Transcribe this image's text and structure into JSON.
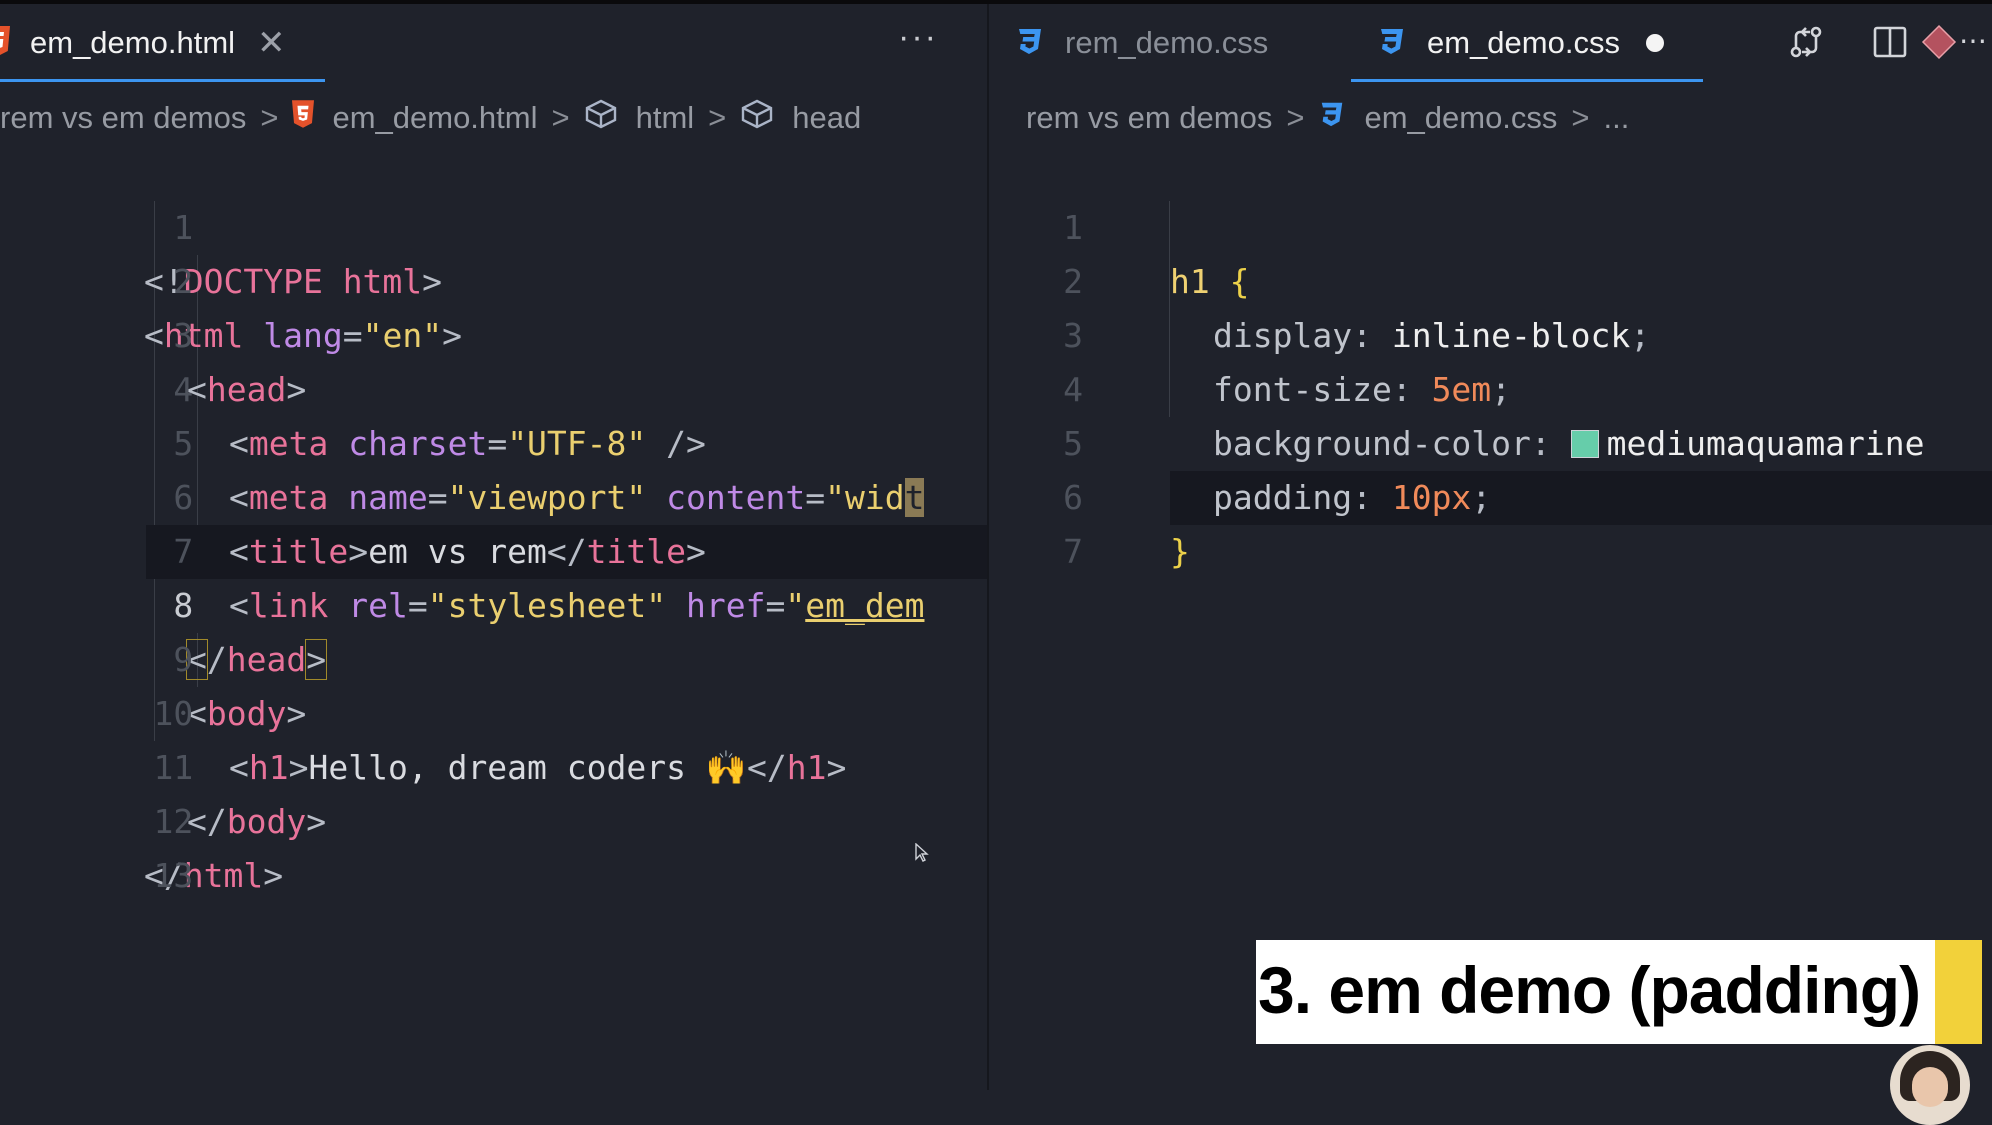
{
  "left_pane": {
    "tab": {
      "label": "em_demo.html",
      "icon": "html5-icon",
      "close_glyph": "✕",
      "active": true
    },
    "more_glyph": "···",
    "breadcrumb": [
      "rem vs em demos",
      "em_demo.html",
      "html",
      "head"
    ],
    "separator": ">",
    "lines": [
      {
        "n": "1"
      },
      {
        "n": "2"
      },
      {
        "n": "3"
      },
      {
        "n": "4"
      },
      {
        "n": "5"
      },
      {
        "n": "6"
      },
      {
        "n": "7"
      },
      {
        "n": "8"
      },
      {
        "n": "9"
      },
      {
        "n": "10"
      },
      {
        "n": "11"
      },
      {
        "n": "12"
      },
      {
        "n": "13"
      }
    ],
    "code": {
      "l1": {
        "a": "<!",
        "b": "DOCTYPE html",
        "c": ">"
      },
      "l2": {
        "a": "<",
        "b": "html",
        "c": "lang",
        "d": "=",
        "e": "\"en\"",
        "f": ">"
      },
      "l3": {
        "a": "<",
        "b": "head",
        "c": ">"
      },
      "l4": {
        "a": "<",
        "b": "meta",
        "c": "charset",
        "d": "=",
        "e": "\"UTF-8\"",
        "f": "/>"
      },
      "l5": {
        "a": "<",
        "b": "meta",
        "c": "name",
        "d": "=",
        "e": "\"viewport\"",
        "f": "content",
        "g": "=",
        "h": "\"wid",
        "i": "t"
      },
      "l6": {
        "a": "<",
        "b": "title",
        "c": ">",
        "d": "em vs rem",
        "e": "</",
        "f": "title",
        "g": ">"
      },
      "l7": {
        "a": "<",
        "b": "link",
        "c": "rel",
        "d": "=",
        "e": "\"stylesheet\"",
        "f": "href",
        "g": "=",
        "h": "\"",
        "i": "em_dem"
      },
      "l8": {
        "a": "<",
        "b": "/",
        "c": "head",
        "d": ">"
      },
      "l9": {
        "a": "<",
        "b": "body",
        "c": ">"
      },
      "l10": {
        "a": "<",
        "b": "h1",
        "c": ">",
        "d": "Hello, dream coders 🙌",
        "e": "</",
        "f": "h1",
        "g": ">"
      },
      "l11": {
        "a": "</",
        "b": "body",
        "c": ">"
      },
      "l12": {
        "a": "</",
        "b": "html",
        "c": ">"
      }
    }
  },
  "right_pane": {
    "tabs": [
      {
        "label": "rem_demo.css",
        "icon": "css3-icon",
        "active": false
      },
      {
        "label": "em_demo.css",
        "icon": "css3-icon",
        "active": true,
        "unsaved": true
      }
    ],
    "toolbar_icons": [
      "compare-changes-icon",
      "split-editor-icon",
      "git-diamond-icon"
    ],
    "breadcrumb": [
      "rem vs em demos",
      "em_demo.css",
      "..."
    ],
    "separator": ">",
    "lines": [
      {
        "n": "1"
      },
      {
        "n": "2"
      },
      {
        "n": "3"
      },
      {
        "n": "4"
      },
      {
        "n": "5"
      },
      {
        "n": "6"
      },
      {
        "n": "7"
      }
    ],
    "code": {
      "l1": {
        "a": "h1",
        "b": "{"
      },
      "l2": {
        "a": "display",
        "b": ":",
        "c": "inline-block",
        "d": ";"
      },
      "l3": {
        "a": "font-size",
        "b": ":",
        "c": "5em",
        "d": ";"
      },
      "l4": {
        "a": "background-color",
        "b": ":",
        "c": "mediumaquamarine",
        "swatch": "#66cdaa"
      },
      "l5": {
        "a": "padding",
        "b": ":",
        "c": "10px",
        "d": ";"
      },
      "l6": {
        "a": "}"
      }
    }
  },
  "caption": {
    "text": "3. em demo (padding)",
    "accent": "#f2d13a"
  },
  "colors": {
    "editor_bg": "#1f222b",
    "tab_underline": "#3c95f0",
    "html_icon": "#e4522b",
    "css_icon": "#3c95f0"
  }
}
